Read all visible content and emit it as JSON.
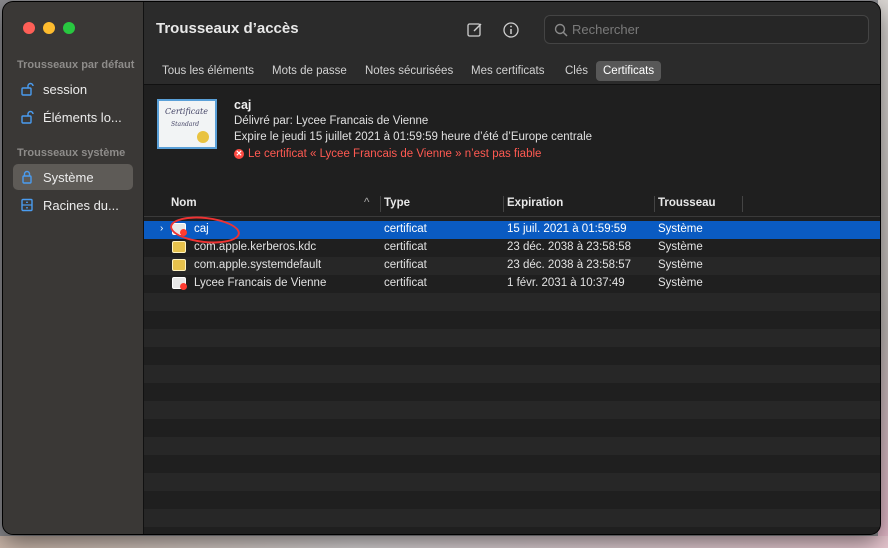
{
  "window": {
    "title": "Trousseaux d’accès",
    "search_placeholder": "Rechercher"
  },
  "sidebar": {
    "section_default": "Trousseaux par défaut",
    "section_system": "Trousseaux système",
    "items": [
      {
        "label": "session",
        "icon": "lock-open-icon"
      },
      {
        "label": "Éléments lo...",
        "icon": "lock-open-icon"
      },
      {
        "label": "Système",
        "icon": "lock-icon",
        "selected": true
      },
      {
        "label": "Racines du...",
        "icon": "cabinet-icon"
      }
    ]
  },
  "tabs": [
    "Tous les éléments",
    "Mots de passe",
    "Notes sécurisées",
    "Mes certificats",
    "Clés",
    "Certificats"
  ],
  "active_tab": "Certificats",
  "detail": {
    "name": "caj",
    "issued_by": "Délivré par: Lycee Francais de Vienne",
    "expires": "Expire le jeudi 15 juillet 2021 à 01:59:59 heure d’été d’Europe centrale",
    "warning": "Le certificat « Lycee Francais de Vienne » n’est pas fiable",
    "thumb_line1": "Certificate",
    "thumb_line2": "Standard"
  },
  "table": {
    "headers": {
      "name": "Nom",
      "type": "Type",
      "expiration": "Expiration",
      "keychain": "Trousseau"
    },
    "rows": [
      {
        "name": "caj",
        "type": "certificat",
        "expiration": "15 juil. 2021 à 01:59:59",
        "keychain": "Système",
        "icon": "certificate-invalid-icon",
        "selected": true
      },
      {
        "name": "com.apple.kerberos.kdc",
        "type": "certificat",
        "expiration": "23 déc. 2038 à 23:58:58",
        "keychain": "Système",
        "icon": "certificate-icon"
      },
      {
        "name": "com.apple.systemdefault",
        "type": "certificat",
        "expiration": "23 déc. 2038 à 23:58:57",
        "keychain": "Système",
        "icon": "certificate-icon"
      },
      {
        "name": "Lycee Francais de Vienne",
        "type": "certificat",
        "expiration": "1 févr. 2031 à 10:37:49",
        "keychain": "Système",
        "icon": "certificate-invalid-icon"
      }
    ]
  },
  "colors": {
    "selection": "#0a5bc2",
    "warning": "#ff5a52",
    "traffic_close": "#fe5f57",
    "traffic_min": "#febc2e",
    "traffic_max": "#28c840"
  }
}
